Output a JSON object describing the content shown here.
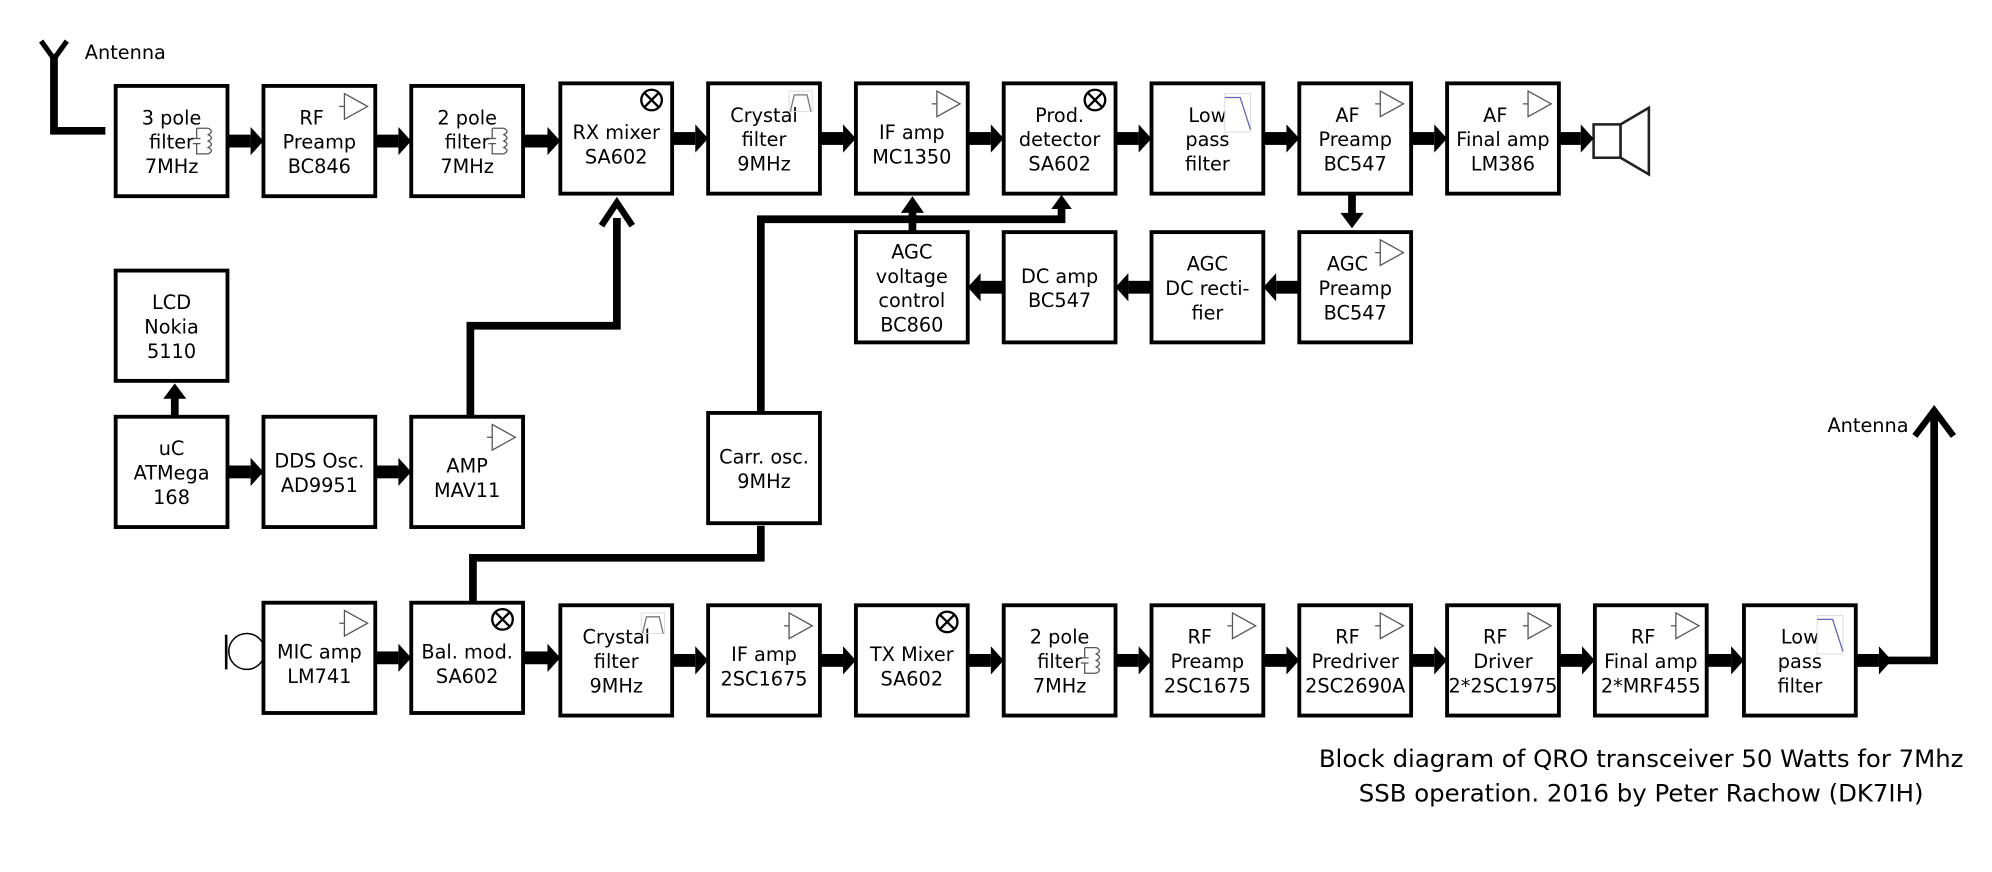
{
  "title": "Block diagram of QRO transceiver 50 Watts for 7Mhz",
  "caption": {
    "line1": "Block diagram of QRO transceiver 50 Watts for 7Mhz",
    "line2": "SSB operation. 2016 by Peter Rachow (DK7IH)"
  },
  "antenna_rx_label": "Antenna",
  "antenna_tx_label": "Antenna",
  "blocks": [
    {
      "id": "rx-3pole",
      "lines": [
        "3 pole",
        "filter",
        "7MHz"
      ],
      "icon": "lc-filter-icon"
    },
    {
      "id": "rx-rf-preamp",
      "lines": [
        "RF",
        "Preamp",
        "BC846"
      ],
      "icon": "amplifier-icon"
    },
    {
      "id": "rx-2pole",
      "lines": [
        "2 pole",
        "filter",
        "7MHz"
      ],
      "icon": "lc-filter-icon"
    },
    {
      "id": "rx-mixer",
      "lines": [
        "RX mixer",
        "SA602"
      ],
      "icon": "mixer-icon"
    },
    {
      "id": "rx-crystal",
      "lines": [
        "Crystal",
        "filter",
        "9MHz"
      ],
      "icon": "bandpass-icon"
    },
    {
      "id": "rx-if-amp",
      "lines": [
        "IF amp",
        "MC1350"
      ],
      "icon": "amplifier-icon"
    },
    {
      "id": "rx-prod-det",
      "lines": [
        "Prod.",
        "detector",
        "SA602"
      ],
      "icon": "mixer-icon"
    },
    {
      "id": "rx-lpf",
      "lines": [
        "Low",
        "pass",
        "filter"
      ],
      "icon": "lowpass-icon"
    },
    {
      "id": "rx-af-preamp",
      "lines": [
        "AF",
        "Preamp",
        "BC547"
      ],
      "icon": "amplifier-icon"
    },
    {
      "id": "rx-af-final",
      "lines": [
        "AF",
        "Final amp",
        "LM386"
      ],
      "icon": "amplifier-icon"
    },
    {
      "id": "agc-voltage",
      "lines": [
        "AGC",
        "voltage",
        "control",
        "BC860"
      ],
      "icon": ""
    },
    {
      "id": "agc-dc-amp",
      "lines": [
        "DC amp",
        "BC547"
      ],
      "icon": ""
    },
    {
      "id": "agc-rectifier",
      "lines": [
        "AGC",
        "DC recti-",
        "fier"
      ],
      "icon": ""
    },
    {
      "id": "agc-preamp",
      "lines": [
        "AGC",
        "Preamp",
        "BC547"
      ],
      "icon": "amplifier-icon"
    },
    {
      "id": "lcd",
      "lines": [
        "LCD",
        "Nokia",
        "5110"
      ],
      "icon": ""
    },
    {
      "id": "uc",
      "lines": [
        "uC",
        "ATMega",
        "168"
      ],
      "icon": ""
    },
    {
      "id": "dds",
      "lines": [
        "DDS Osc.",
        "AD9951"
      ],
      "icon": ""
    },
    {
      "id": "amp-mav11",
      "lines": [
        "AMP",
        "MAV11"
      ],
      "icon": "amplifier-icon"
    },
    {
      "id": "carrier-osc",
      "lines": [
        "Carr. osc.",
        "9MHz"
      ],
      "icon": ""
    },
    {
      "id": "tx-mic-amp",
      "lines": [
        "MIC amp",
        "LM741"
      ],
      "icon": "amplifier-icon"
    },
    {
      "id": "tx-bal-mod",
      "lines": [
        "Bal. mod.",
        "SA602"
      ],
      "icon": "mixer-icon"
    },
    {
      "id": "tx-crystal",
      "lines": [
        "Crystal",
        "filter",
        "9MHz"
      ],
      "icon": "bandpass-icon"
    },
    {
      "id": "tx-if-amp",
      "lines": [
        "IF amp",
        "2SC1675"
      ],
      "icon": "amplifier-icon"
    },
    {
      "id": "tx-mixer",
      "lines": [
        "TX Mixer",
        "SA602"
      ],
      "icon": "mixer-icon"
    },
    {
      "id": "tx-2pole",
      "lines": [
        "2 pole",
        "filter",
        "7MHz"
      ],
      "icon": "lc-filter-icon"
    },
    {
      "id": "tx-rf-preamp",
      "lines": [
        "RF",
        "Preamp",
        "2SC1675"
      ],
      "icon": "amplifier-icon"
    },
    {
      "id": "tx-predriver",
      "lines": [
        "RF",
        "Predriver",
        "2SC2690A"
      ],
      "icon": "amplifier-icon"
    },
    {
      "id": "tx-driver",
      "lines": [
        "RF",
        "Driver",
        "2*2SC1975"
      ],
      "icon": "amplifier-icon"
    },
    {
      "id": "tx-final",
      "lines": [
        "RF",
        "Final amp",
        "2*MRF455"
      ],
      "icon": "amplifier-icon"
    },
    {
      "id": "tx-lpf",
      "lines": [
        "Low",
        "pass",
        "filter"
      ],
      "icon": "lowpass-icon"
    }
  ],
  "connections": [
    [
      "rx-3pole",
      "rx-rf-preamp"
    ],
    [
      "rx-rf-preamp",
      "rx-2pole"
    ],
    [
      "rx-2pole",
      "rx-mixer"
    ],
    [
      "rx-mixer",
      "rx-crystal"
    ],
    [
      "rx-crystal",
      "rx-if-amp"
    ],
    [
      "rx-if-amp",
      "rx-prod-det"
    ],
    [
      "rx-prod-det",
      "rx-lpf"
    ],
    [
      "rx-lpf",
      "rx-af-preamp"
    ],
    [
      "rx-af-preamp",
      "rx-af-final"
    ],
    [
      "rx-af-final",
      "speaker"
    ],
    [
      "rx-af-preamp",
      "agc-preamp"
    ],
    [
      "agc-preamp",
      "agc-rectifier"
    ],
    [
      "agc-rectifier",
      "agc-dc-amp"
    ],
    [
      "agc-dc-amp",
      "agc-voltage"
    ],
    [
      "agc-voltage",
      "rx-if-amp"
    ],
    [
      "uc",
      "lcd"
    ],
    [
      "uc",
      "dds"
    ],
    [
      "dds",
      "amp-mav11"
    ],
    [
      "amp-mav11",
      "rx-mixer"
    ],
    [
      "amp-mav11",
      "tx-mixer"
    ],
    [
      "carrier-osc",
      "rx-prod-det"
    ],
    [
      "carrier-osc",
      "tx-bal-mod"
    ],
    [
      "microphone",
      "tx-mic-amp"
    ],
    [
      "tx-mic-amp",
      "tx-bal-mod"
    ],
    [
      "tx-bal-mod",
      "tx-crystal"
    ],
    [
      "tx-crystal",
      "tx-if-amp"
    ],
    [
      "tx-if-amp",
      "tx-mixer"
    ],
    [
      "tx-mixer",
      "tx-2pole"
    ],
    [
      "tx-2pole",
      "tx-rf-preamp"
    ],
    [
      "tx-rf-preamp",
      "tx-predriver"
    ],
    [
      "tx-predriver",
      "tx-driver"
    ],
    [
      "tx-driver",
      "tx-final"
    ],
    [
      "tx-final",
      "tx-lpf"
    ],
    [
      "tx-lpf",
      "antenna-tx"
    ],
    [
      "antenna-rx",
      "rx-3pole"
    ]
  ]
}
